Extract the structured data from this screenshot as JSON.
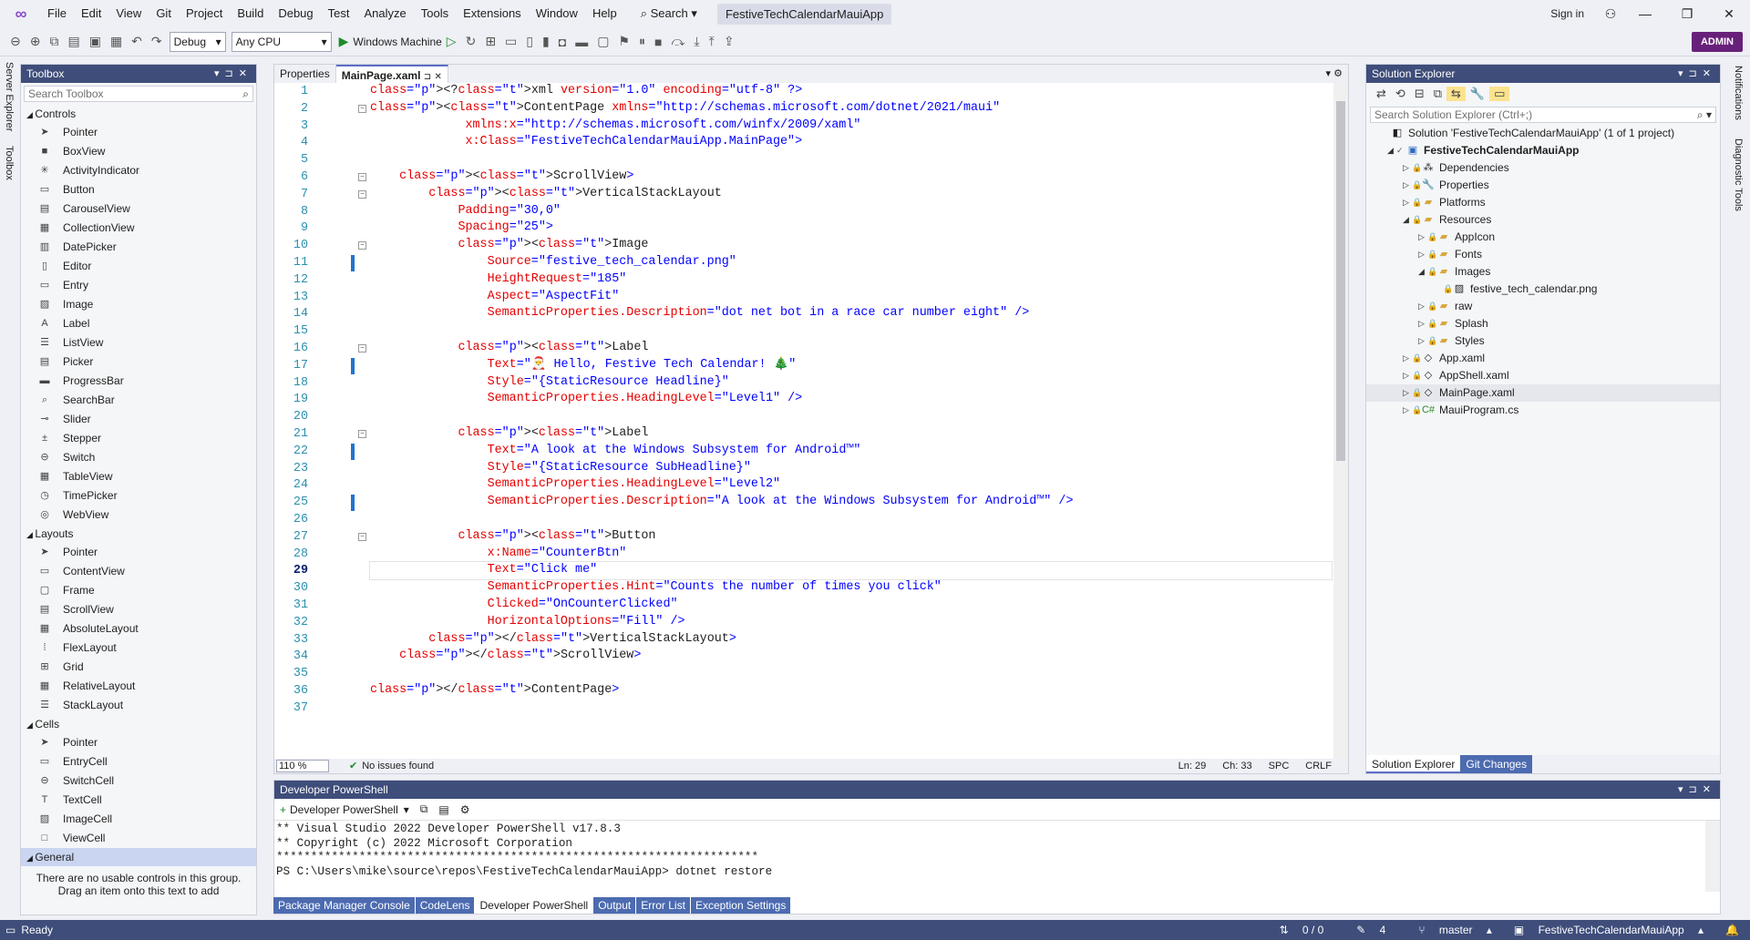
{
  "title_bar": {
    "menu": [
      "File",
      "Edit",
      "View",
      "Git",
      "Project",
      "Build",
      "Debug",
      "Test",
      "Analyze",
      "Tools",
      "Extensions",
      "Window",
      "Help"
    ],
    "search_label": "Search",
    "app_title": "FestiveTechCalendarMauiApp",
    "sign_in": "Sign in",
    "minimize": "—",
    "maximize": "❐",
    "close": "✕"
  },
  "toolbar": {
    "configuration": "Debug",
    "platform": "Any CPU",
    "run_target": "Windows Machine",
    "admin_label": "ADMIN"
  },
  "left_strip": [
    "Server Explorer",
    "Toolbox"
  ],
  "right_strip": [
    "Notifications",
    "Diagnostic Tools"
  ],
  "toolbox": {
    "title": "Toolbox",
    "search_placeholder": "Search Toolbox",
    "groups": [
      {
        "name": "Controls",
        "items": [
          "Pointer",
          "BoxView",
          "ActivityIndicator",
          "Button",
          "CarouselView",
          "CollectionView",
          "DatePicker",
          "Editor",
          "Entry",
          "Image",
          "Label",
          "ListView",
          "Picker",
          "ProgressBar",
          "SearchBar",
          "Slider",
          "Stepper",
          "Switch",
          "TableView",
          "TimePicker",
          "WebView"
        ]
      },
      {
        "name": "Layouts",
        "items": [
          "Pointer",
          "ContentView",
          "Frame",
          "ScrollView",
          "AbsoluteLayout",
          "FlexLayout",
          "Grid",
          "RelativeLayout",
          "StackLayout"
        ]
      },
      {
        "name": "Cells",
        "items": [
          "Pointer",
          "EntryCell",
          "SwitchCell",
          "TextCell",
          "ImageCell",
          "ViewCell"
        ]
      },
      {
        "name": "General",
        "items": []
      }
    ],
    "empty_text": "There are no usable controls in this group. Drag an item onto this text to add"
  },
  "editor": {
    "tabs": [
      "Properties",
      "MainPage.xaml"
    ],
    "active_tab": "MainPage.xaml",
    "zoom": "110 %",
    "issues": "No issues found",
    "ln": "Ln: 29",
    "ch": "Ch: 33",
    "spc": "SPC",
    "crlf": "CRLF",
    "current_line": 29,
    "lines": [
      "<?xml version=\"1.0\" encoding=\"utf-8\" ?>",
      "<ContentPage xmlns=\"http://schemas.microsoft.com/dotnet/2021/maui\"",
      "             xmlns:x=\"http://schemas.microsoft.com/winfx/2009/xaml\"",
      "             x:Class=\"FestiveTechCalendarMauiApp.MainPage\">",
      "",
      "    <ScrollView>",
      "        <VerticalStackLayout",
      "            Padding=\"30,0\"",
      "            Spacing=\"25\">",
      "            <Image",
      "                Source=\"festive_tech_calendar.png\"",
      "                HeightRequest=\"185\"",
      "                Aspect=\"AspectFit\"",
      "                SemanticProperties.Description=\"dot net bot in a race car number eight\" />",
      "",
      "            <Label",
      "                Text=\"🎅 Hello, Festive Tech Calendar! 🎄\"",
      "                Style=\"{StaticResource Headline}\"",
      "                SemanticProperties.HeadingLevel=\"Level1\" />",
      "",
      "            <Label",
      "                Text=\"A look at the Windows Subsystem for Android™\"",
      "                Style=\"{StaticResource SubHeadline}\"",
      "                SemanticProperties.HeadingLevel=\"Level2\"",
      "                SemanticProperties.Description=\"A look at the Windows Subsystem for Android™\" />",
      "",
      "            <Button",
      "                x:Name=\"CounterBtn\"",
      "                Text=\"Click me\"",
      "                SemanticProperties.Hint=\"Counts the number of times you click\"",
      "                Clicked=\"OnCounterClicked\"",
      "                HorizontalOptions=\"Fill\" />",
      "        </VerticalStackLayout>",
      "    </ScrollView>",
      "",
      "</ContentPage>",
      ""
    ]
  },
  "solution_explorer": {
    "title": "Solution Explorer",
    "search_placeholder": "Search Solution Explorer (Ctrl+;)",
    "tree": [
      {
        "depth": 0,
        "expander": "",
        "label": "Solution 'FestiveTechCalendarMauiApp' (1 of 1 project)",
        "icon": "solution-icon"
      },
      {
        "depth": 1,
        "expander": "◢",
        "label": "FestiveTechCalendarMauiApp",
        "icon": "project-icon",
        "bold": true
      },
      {
        "depth": 2,
        "expander": "▷",
        "label": "Dependencies",
        "icon": "dependencies-icon"
      },
      {
        "depth": 2,
        "expander": "▷",
        "label": "Properties",
        "icon": "properties-folder-icon"
      },
      {
        "depth": 2,
        "expander": "▷",
        "label": "Platforms",
        "icon": "folder-icon"
      },
      {
        "depth": 2,
        "expander": "◢",
        "label": "Resources",
        "icon": "folder-icon"
      },
      {
        "depth": 3,
        "expander": "▷",
        "label": "AppIcon",
        "icon": "folder-icon"
      },
      {
        "depth": 3,
        "expander": "▷",
        "label": "Fonts",
        "icon": "folder-icon"
      },
      {
        "depth": 3,
        "expander": "◢",
        "label": "Images",
        "icon": "folder-icon"
      },
      {
        "depth": 4,
        "expander": "",
        "label": "festive_tech_calendar.png",
        "icon": "image-file-icon"
      },
      {
        "depth": 3,
        "expander": "▷",
        "label": "raw",
        "icon": "folder-icon"
      },
      {
        "depth": 3,
        "expander": "▷",
        "label": "Splash",
        "icon": "folder-icon"
      },
      {
        "depth": 3,
        "expander": "▷",
        "label": "Styles",
        "icon": "folder-icon"
      },
      {
        "depth": 2,
        "expander": "▷",
        "label": "App.xaml",
        "icon": "xaml-file-icon"
      },
      {
        "depth": 2,
        "expander": "▷",
        "label": "AppShell.xaml",
        "icon": "xaml-file-icon"
      },
      {
        "depth": 2,
        "expander": "▷",
        "label": "MainPage.xaml",
        "icon": "xaml-file-icon",
        "selected": true
      },
      {
        "depth": 2,
        "expander": "▷",
        "label": "MauiProgram.cs",
        "icon": "csharp-file-icon"
      }
    ],
    "tabs": [
      "Solution Explorer",
      "Git Changes"
    ]
  },
  "terminal": {
    "title": "Developer PowerShell",
    "dropdown": "Developer PowerShell",
    "lines": [
      "** Visual Studio 2022 Developer PowerShell v17.8.3",
      "** Copyright (c) 2022 Microsoft Corporation",
      "**********************************************************************",
      "PS C:\\Users\\mike\\source\\repos\\FestiveTechCalendarMauiApp> dotnet restore"
    ]
  },
  "bottom_tabs": [
    "Package Manager Console",
    "CodeLens",
    "Developer PowerShell",
    "Output",
    "Error List",
    "Exception Settings"
  ],
  "active_bottom_tab": "Developer PowerShell",
  "status_bar": {
    "ready": "Ready",
    "sync": "0 / 0",
    "edits": "4",
    "branch": "master",
    "repo": "FestiveTechCalendarMauiApp"
  }
}
